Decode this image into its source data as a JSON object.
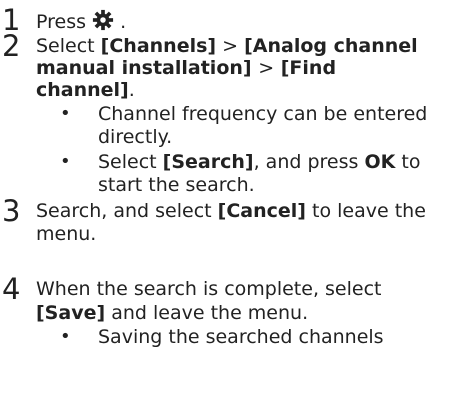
{
  "steps": [
    {
      "number": "1",
      "press": "Press",
      "after_icon": ".",
      "icon": "gear-icon"
    },
    {
      "number": "2",
      "select": "Select",
      "channels": "[Channels]",
      "sep1": ">",
      "analog_part1": "[Analog channel",
      "analog_part2": "manual installation]",
      "sep2": ">",
      "find_part1": "[Find",
      "find_part2": "channel]",
      "period": ".",
      "bullets": [
        {
          "line1": "Channel frequency can be entered",
          "line2": "directly."
        },
        {
          "select": "Select",
          "search": "[Search]",
          "and_press": ", and press",
          "ok": "OK",
          "to": "to",
          "line2": "start the search."
        }
      ]
    },
    {
      "number": "3",
      "text_pre": "Search, and select",
      "cancel": "[Cancel]",
      "text_post": "to leave the",
      "line2": "menu."
    },
    {
      "number": "4",
      "line1": "When the search is complete, select",
      "save": "[Save]",
      "line2_post": "and leave the menu.",
      "bullets": [
        {
          "line1": "Saving the searched channels"
        }
      ]
    }
  ]
}
